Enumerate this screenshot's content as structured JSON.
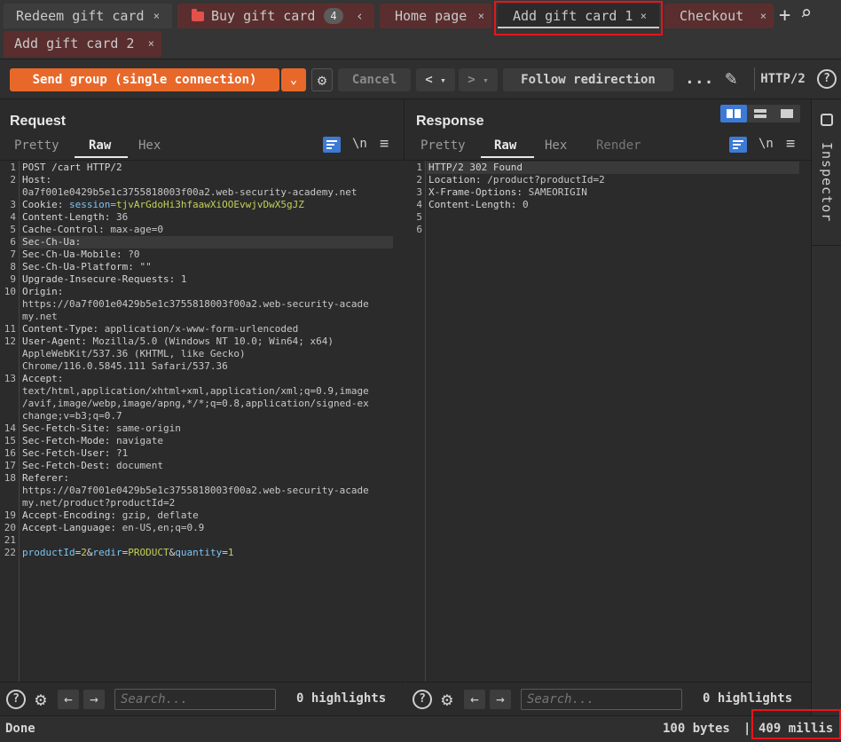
{
  "tabs": [
    {
      "label": "Redeem gift card",
      "close": "×"
    },
    {
      "label": "Buy gift card",
      "count": "4",
      "nav": "‹"
    },
    {
      "label": "Home page",
      "close": "×"
    },
    {
      "label": "Add gift card 1",
      "close": "×"
    },
    {
      "label": "Checkout",
      "close": "×"
    },
    {
      "label": "Add gift card 2",
      "close": "×"
    }
  ],
  "tab_actions": {
    "add": "+",
    "search": "⌕"
  },
  "toolbar": {
    "send_label": "Send group (single connection)",
    "send_dropdown": "⌄",
    "settings_icon": "⚙",
    "cancel_label": "Cancel",
    "back": "<",
    "back_drop": "▾",
    "forward": ">",
    "forward_drop": "▾",
    "follow_label": "Follow redirection",
    "more": "...",
    "edit_icon": "✎",
    "protocol": "HTTP/2",
    "help": "?"
  },
  "request": {
    "title": "Request",
    "tabs": [
      "Pretty",
      "Raw",
      "Hex"
    ],
    "newline_label": "\\n",
    "menu": "≡",
    "lines": [
      {
        "n": "1",
        "k": "POST /cart HTTP/2",
        "v": ""
      },
      {
        "n": "2",
        "k": "Host:",
        "v": ""
      },
      {
        "n": "",
        "k": "",
        "v": "0a7f001e0429b5e1c3755818003f00a2.web-security-academy.net"
      },
      {
        "n": "3",
        "k": "Cookie: ",
        "p": "session=",
        "c": "tjvArGdoHi3hfaawXiOOEvwjvDwX5gJZ"
      },
      {
        "n": "4",
        "k": "Content-Length: ",
        "v": "36"
      },
      {
        "n": "5",
        "k": "Cache-Control: ",
        "v": "max-age=0"
      },
      {
        "n": "6",
        "k": "Sec-Ch-Ua:",
        "v": ""
      },
      {
        "n": "7",
        "k": "Sec-Ch-Ua-Mobile: ",
        "v": "?0"
      },
      {
        "n": "8",
        "k": "Sec-Ch-Ua-Platform: ",
        "v": "\"\""
      },
      {
        "n": "9",
        "k": "Upgrade-Insecure-Requests: ",
        "v": "1"
      },
      {
        "n": "10",
        "k": "Origin:",
        "v": ""
      },
      {
        "n": "",
        "k": "",
        "v": "https://0a7f001e0429b5e1c3755818003f00a2.web-security-acade"
      },
      {
        "n": "",
        "k": "",
        "v": "my.net"
      },
      {
        "n": "11",
        "k": "Content-Type: ",
        "v": "application/x-www-form-urlencoded"
      },
      {
        "n": "12",
        "k": "User-Agent: ",
        "v": "Mozilla/5.0 (Windows NT 10.0; Win64; x64)"
      },
      {
        "n": "",
        "k": "",
        "v": "AppleWebKit/537.36 (KHTML, like Gecko)"
      },
      {
        "n": "",
        "k": "",
        "v": "Chrome/116.0.5845.111 Safari/537.36"
      },
      {
        "n": "13",
        "k": "Accept:",
        "v": ""
      },
      {
        "n": "",
        "k": "",
        "v": "text/html,application/xhtml+xml,application/xml;q=0.9,image"
      },
      {
        "n": "",
        "k": "",
        "v": "/avif,image/webp,image/apng,*/*;q=0.8,application/signed-ex"
      },
      {
        "n": "",
        "k": "",
        "v": "change;v=b3;q=0.7"
      },
      {
        "n": "14",
        "k": "Sec-Fetch-Site: ",
        "v": "same-origin"
      },
      {
        "n": "15",
        "k": "Sec-Fetch-Mode: ",
        "v": "navigate"
      },
      {
        "n": "16",
        "k": "Sec-Fetch-User: ",
        "v": "?1"
      },
      {
        "n": "17",
        "k": "Sec-Fetch-Dest: ",
        "v": "document"
      },
      {
        "n": "18",
        "k": "Referer:",
        "v": ""
      },
      {
        "n": "",
        "k": "",
        "v": "https://0a7f001e0429b5e1c3755818003f00a2.web-security-acade"
      },
      {
        "n": "",
        "k": "",
        "v": "my.net/product?productId=2"
      },
      {
        "n": "19",
        "k": "Accept-Encoding: ",
        "v": "gzip, deflate"
      },
      {
        "n": "20",
        "k": "Accept-Language: ",
        "v": "en-US,en;q=0.9"
      },
      {
        "n": "21",
        "k": "",
        "v": ""
      },
      {
        "n": "22",
        "body": true,
        "parts": [
          [
            "productId",
            "="
          ],
          [
            "2",
            "&"
          ],
          [
            "redir",
            "="
          ],
          [
            "PRODUCT",
            "&"
          ],
          [
            "quantity",
            "="
          ],
          [
            "1",
            ""
          ]
        ]
      }
    ],
    "search_placeholder": "Search...",
    "highlights": "0 highlights"
  },
  "response": {
    "title": "Response",
    "tabs": [
      "Pretty",
      "Raw",
      "Hex",
      "Render"
    ],
    "newline_label": "\\n",
    "menu": "≡",
    "lines": [
      {
        "n": "1",
        "k": "HTTP/2 302 Found",
        "v": ""
      },
      {
        "n": "2",
        "k": "Location: ",
        "v": "/product?productId=2"
      },
      {
        "n": "3",
        "k": "X-Frame-Options: ",
        "v": "SAMEORIGIN"
      },
      {
        "n": "4",
        "k": "Content-Length: ",
        "v": "0"
      },
      {
        "n": "5",
        "k": "",
        "v": ""
      },
      {
        "n": "6",
        "k": "",
        "v": ""
      }
    ],
    "search_placeholder": "Search...",
    "highlights": "0 highlights"
  },
  "inspector": {
    "label": "Inspector"
  },
  "status": {
    "left": "Done",
    "bytes": "100 bytes",
    "sep": "|",
    "millis": "409 millis"
  },
  "colors": {
    "accent": "#e8682a",
    "highlight_frame": "#e8141b",
    "wrap_button": "#3d7ad6",
    "cookie_value": "#c3d158",
    "param_name": "#7cc4f2"
  }
}
